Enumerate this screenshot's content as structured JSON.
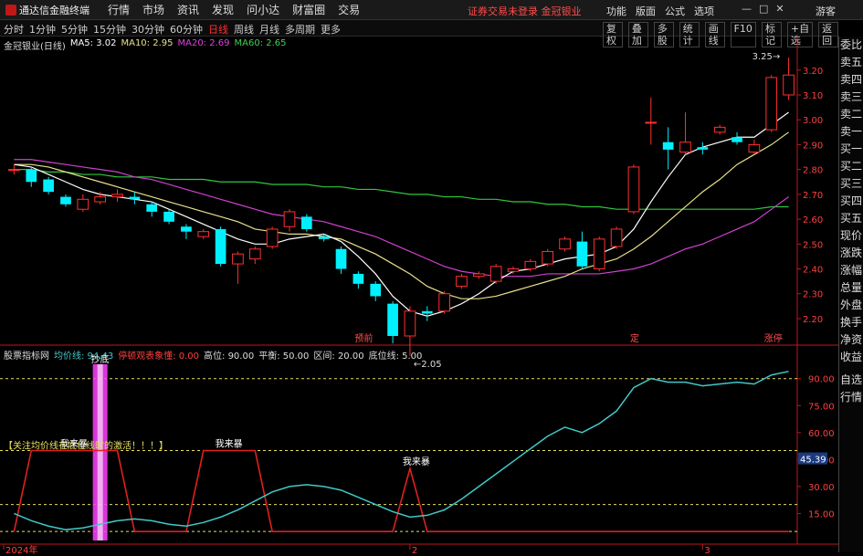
{
  "app": {
    "name": "通达信金融终端"
  },
  "menu": [
    "行情",
    "市场",
    "资讯",
    "发现",
    "问小达",
    "财富圈",
    "交易"
  ],
  "notice": "证券交易未登录",
  "stock_tab": "金冠银业",
  "right_menu": [
    "功能",
    "版面",
    "公式",
    "选项"
  ],
  "guest": "游客",
  "periods": [
    "分时",
    "1分钟",
    "5分钟",
    "15分钟",
    "30分钟",
    "60分钟",
    "日线",
    "周线",
    "月线",
    "多周期",
    "更多"
  ],
  "active_period": "日线",
  "tools": [
    "复权",
    "叠加",
    "多股",
    "统计",
    "画线",
    "F10",
    "标记",
    "+自选",
    "返回"
  ],
  "right_panel": [
    "委比",
    "卖五",
    "卖四",
    "卖三",
    "卖二",
    "卖一",
    "买一",
    "买二",
    "买三",
    "买四",
    "买五",
    "现价",
    "涨跌",
    "涨幅",
    "总量",
    "外盘",
    "换手",
    "净资",
    "收益"
  ],
  "right_panel_bottom": [
    "自选",
    "行情"
  ],
  "main_legend": {
    "title": "金冠银业(日线)",
    "ma5": "MA5: 3.02",
    "ma10": "MA10: 2.95",
    "ma20": "MA20: 2.69",
    "ma60": "MA60: 2.65"
  },
  "sub_legend": {
    "title": "股票指标网",
    "avg": "均价线: 94.43",
    "rate": "停顿观表象懂: 0.00",
    "high": "高位: 90.00",
    "bal": "平衡: 50.00",
    "zone": "区间: 20.00",
    "low": "底位线: 5.00"
  },
  "annotations": {
    "high_price": "3.25",
    "low_price": "2.05",
    "tag1": "预前",
    "tag2": "定",
    "tag3": "涨停",
    "note": "【关注均价线在底位线时的激活！！！】",
    "signal": "我来暴",
    "signal_top": "抄底",
    "cur_value": "45.39"
  },
  "colors": {
    "up": "#ff3030",
    "down": "#00f0ff",
    "ma5": "#ffffff",
    "ma10": "#e8e08a",
    "ma20": "#d040d0",
    "ma60": "#2fc83c",
    "axis": "#c01818",
    "sub_line": "#40c8c8",
    "signal": "#e02020",
    "highlight": "#ff40ff"
  },
  "chart_data": [
    {
      "type": "candlestick",
      "title": "金冠银业(日线)",
      "y_ticks": [
        2.2,
        2.3,
        2.4,
        2.5,
        2.6,
        2.7,
        2.8,
        2.9,
        3.0,
        3.1,
        3.2
      ],
      "ylim": [
        2.13,
        3.28
      ],
      "x_ticks": [
        "2024年",
        "2",
        "3"
      ],
      "candles": [
        {
          "o": 2.8,
          "c": 2.8,
          "h": 2.82,
          "l": 2.78
        },
        {
          "o": 2.8,
          "c": 2.75,
          "h": 2.81,
          "l": 2.73
        },
        {
          "o": 2.76,
          "c": 2.71,
          "h": 2.77,
          "l": 2.7
        },
        {
          "o": 2.69,
          "c": 2.66,
          "h": 2.7,
          "l": 2.65
        },
        {
          "o": 2.64,
          "c": 2.68,
          "h": 2.7,
          "l": 2.63
        },
        {
          "o": 2.67,
          "c": 2.69,
          "h": 2.71,
          "l": 2.66
        },
        {
          "o": 2.69,
          "c": 2.7,
          "h": 2.72,
          "l": 2.67
        },
        {
          "o": 2.69,
          "c": 2.68,
          "h": 2.71,
          "l": 2.66
        },
        {
          "o": 2.66,
          "c": 2.63,
          "h": 2.67,
          "l": 2.61
        },
        {
          "o": 2.63,
          "c": 2.59,
          "h": 2.64,
          "l": 2.58
        },
        {
          "o": 2.57,
          "c": 2.55,
          "h": 2.58,
          "l": 2.52
        },
        {
          "o": 2.53,
          "c": 2.55,
          "h": 2.56,
          "l": 2.52
        },
        {
          "o": 2.56,
          "c": 2.42,
          "h": 2.57,
          "l": 2.41
        },
        {
          "o": 2.42,
          "c": 2.46,
          "h": 2.47,
          "l": 2.34
        },
        {
          "o": 2.44,
          "c": 2.48,
          "h": 2.49,
          "l": 2.42
        },
        {
          "o": 2.49,
          "c": 2.56,
          "h": 2.57,
          "l": 2.48
        },
        {
          "o": 2.57,
          "c": 2.63,
          "h": 2.64,
          "l": 2.55
        },
        {
          "o": 2.61,
          "c": 2.56,
          "h": 2.62,
          "l": 2.55
        },
        {
          "o": 2.53,
          "c": 2.52,
          "h": 2.54,
          "l": 2.51
        },
        {
          "o": 2.48,
          "c": 2.4,
          "h": 2.49,
          "l": 2.38
        },
        {
          "o": 2.38,
          "c": 2.34,
          "h": 2.39,
          "l": 2.32
        },
        {
          "o": 2.34,
          "c": 2.29,
          "h": 2.35,
          "l": 2.27
        },
        {
          "o": 2.26,
          "c": 2.13,
          "h": 2.27,
          "l": 2.1
        },
        {
          "o": 2.13,
          "c": 2.23,
          "h": 2.25,
          "l": 2.05
        },
        {
          "o": 2.23,
          "c": 2.22,
          "h": 2.25,
          "l": 2.19
        },
        {
          "o": 2.23,
          "c": 2.3,
          "h": 2.31,
          "l": 2.22
        },
        {
          "o": 2.33,
          "c": 2.37,
          "h": 2.38,
          "l": 2.32
        },
        {
          "o": 2.37,
          "c": 2.38,
          "h": 2.39,
          "l": 2.36
        },
        {
          "o": 2.35,
          "c": 2.41,
          "h": 2.42,
          "l": 2.34
        },
        {
          "o": 2.39,
          "c": 2.4,
          "h": 2.41,
          "l": 2.38
        },
        {
          "o": 2.4,
          "c": 2.43,
          "h": 2.44,
          "l": 2.39
        },
        {
          "o": 2.42,
          "c": 2.47,
          "h": 2.48,
          "l": 2.41
        },
        {
          "o": 2.48,
          "c": 2.52,
          "h": 2.53,
          "l": 2.47
        },
        {
          "o": 2.51,
          "c": 2.41,
          "h": 2.55,
          "l": 2.4
        },
        {
          "o": 2.4,
          "c": 2.52,
          "h": 2.53,
          "l": 2.39
        },
        {
          "o": 2.49,
          "c": 2.56,
          "h": 2.57,
          "l": 2.48
        },
        {
          "o": 2.63,
          "c": 2.81,
          "h": 2.82,
          "l": 2.62
        },
        {
          "o": 2.99,
          "c": 2.99,
          "h": 3.09,
          "l": 2.9
        },
        {
          "o": 2.91,
          "c": 2.88,
          "h": 2.97,
          "l": 2.8
        },
        {
          "o": 2.87,
          "c": 2.91,
          "h": 3.03,
          "l": 2.86
        },
        {
          "o": 2.89,
          "c": 2.88,
          "h": 2.91,
          "l": 2.86
        },
        {
          "o": 2.95,
          "c": 2.97,
          "h": 2.98,
          "l": 2.94
        },
        {
          "o": 2.93,
          "c": 2.91,
          "h": 2.95,
          "l": 2.9
        },
        {
          "o": 2.87,
          "c": 2.9,
          "h": 2.92,
          "l": 2.86
        },
        {
          "o": 2.96,
          "c": 3.17,
          "h": 3.18,
          "l": 2.95
        },
        {
          "o": 3.1,
          "c": 3.18,
          "h": 3.25,
          "l": 3.08
        }
      ],
      "series": [
        {
          "name": "MA5",
          "values": [
            2.82,
            2.81,
            2.78,
            2.75,
            2.72,
            2.7,
            2.69,
            2.68,
            2.67,
            2.64,
            2.61,
            2.58,
            2.55,
            2.52,
            2.5,
            2.5,
            2.52,
            2.53,
            2.54,
            2.51,
            2.45,
            2.38,
            2.29,
            2.23,
            2.21,
            2.23,
            2.26,
            2.3,
            2.35,
            2.39,
            2.4,
            2.42,
            2.44,
            2.45,
            2.46,
            2.49,
            2.56,
            2.67,
            2.77,
            2.86,
            2.89,
            2.91,
            2.93,
            2.93,
            2.98,
            3.03
          ]
        },
        {
          "name": "MA10",
          "values": [
            2.82,
            2.82,
            2.81,
            2.79,
            2.77,
            2.75,
            2.73,
            2.71,
            2.69,
            2.67,
            2.65,
            2.63,
            2.61,
            2.59,
            2.56,
            2.55,
            2.54,
            2.54,
            2.53,
            2.52,
            2.49,
            2.46,
            2.42,
            2.38,
            2.33,
            2.3,
            2.28,
            2.28,
            2.29,
            2.31,
            2.33,
            2.35,
            2.37,
            2.4,
            2.42,
            2.44,
            2.48,
            2.53,
            2.59,
            2.65,
            2.71,
            2.76,
            2.82,
            2.86,
            2.9,
            2.95
          ]
        },
        {
          "name": "MA20",
          "values": [
            2.84,
            2.84,
            2.83,
            2.82,
            2.81,
            2.8,
            2.79,
            2.77,
            2.76,
            2.74,
            2.72,
            2.7,
            2.68,
            2.66,
            2.64,
            2.62,
            2.61,
            2.6,
            2.59,
            2.57,
            2.55,
            2.53,
            2.5,
            2.47,
            2.44,
            2.41,
            2.39,
            2.38,
            2.37,
            2.37,
            2.37,
            2.38,
            2.38,
            2.38,
            2.38,
            2.39,
            2.4,
            2.42,
            2.45,
            2.48,
            2.5,
            2.53,
            2.56,
            2.59,
            2.64,
            2.69
          ]
        },
        {
          "name": "MA60",
          "values": [
            2.8,
            2.8,
            2.79,
            2.79,
            2.78,
            2.78,
            2.77,
            2.77,
            2.77,
            2.76,
            2.76,
            2.76,
            2.75,
            2.75,
            2.75,
            2.74,
            2.74,
            2.74,
            2.73,
            2.73,
            2.72,
            2.72,
            2.71,
            2.7,
            2.7,
            2.69,
            2.69,
            2.68,
            2.68,
            2.67,
            2.67,
            2.66,
            2.66,
            2.65,
            2.65,
            2.64,
            2.64,
            2.64,
            2.64,
            2.64,
            2.64,
            2.64,
            2.64,
            2.64,
            2.65,
            2.65
          ]
        }
      ]
    },
    {
      "type": "line",
      "title": "股票指标网",
      "y_ticks": [
        15.0,
        30.0,
        45.0,
        60.0,
        75.0,
        90.0
      ],
      "ylim": [
        0,
        100
      ],
      "reference_lines": [
        90,
        50,
        20,
        5
      ],
      "series": [
        {
          "name": "均价线",
          "values": [
            15,
            11,
            8,
            6,
            7,
            9,
            11,
            12,
            11,
            9,
            8,
            10,
            13,
            17,
            22,
            27,
            30,
            31,
            30,
            28,
            24,
            20,
            16,
            13,
            14,
            17,
            23,
            30,
            37,
            44,
            51,
            58,
            63,
            60,
            65,
            72,
            85,
            90,
            88,
            88,
            86,
            87,
            88,
            87,
            92,
            94
          ]
        },
        {
          "name": "停顿观表象懂",
          "values": [
            5,
            50,
            50,
            50,
            50,
            50,
            50,
            5,
            5,
            5,
            5,
            50,
            50,
            50,
            50,
            5,
            5,
            5,
            5,
            5,
            5,
            5,
            5,
            40,
            5,
            5,
            5,
            5,
            5,
            5,
            5,
            5,
            5,
            5,
            5,
            5,
            5,
            5,
            5,
            5,
            5,
            5,
            5,
            5,
            5,
            5
          ]
        }
      ]
    }
  ]
}
